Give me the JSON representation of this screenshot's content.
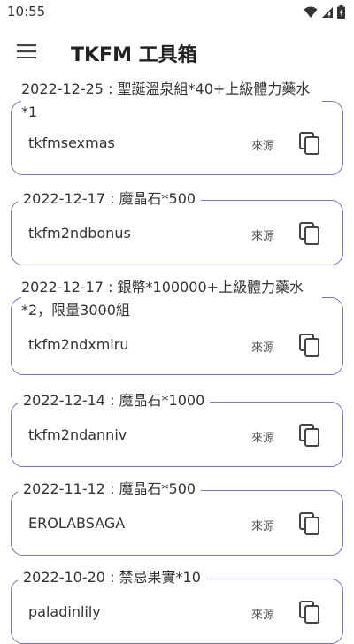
{
  "status_bar": {
    "time": "10:55"
  },
  "app_bar": {
    "title": "TKFM 工具箱"
  },
  "entries": [
    {
      "title": "2022-12-25 : 聖誕溫泉組*40+上級體力藥水\n*1",
      "code": "tkfmsexmas",
      "source_label": "來源"
    },
    {
      "title": "2022-12-17 : 魔晶石*500",
      "code": "tkfm2ndbonus",
      "source_label": "來源"
    },
    {
      "title": "2022-12-17 : 銀幣*100000+上級體力藥水\n*2，限量3000組",
      "code": "tkfm2ndxmiru",
      "source_label": "來源"
    },
    {
      "title": "2022-12-14 : 魔晶石*1000",
      "code": "tkfm2ndanniv",
      "source_label": "來源"
    },
    {
      "title": "2022-11-12 : 魔晶石*500",
      "code": "EROLABSAGA",
      "source_label": "來源"
    },
    {
      "title": "2022-10-20 : 禁忌果實*10",
      "code": "paladinlily",
      "source_label": "來源"
    }
  ]
}
